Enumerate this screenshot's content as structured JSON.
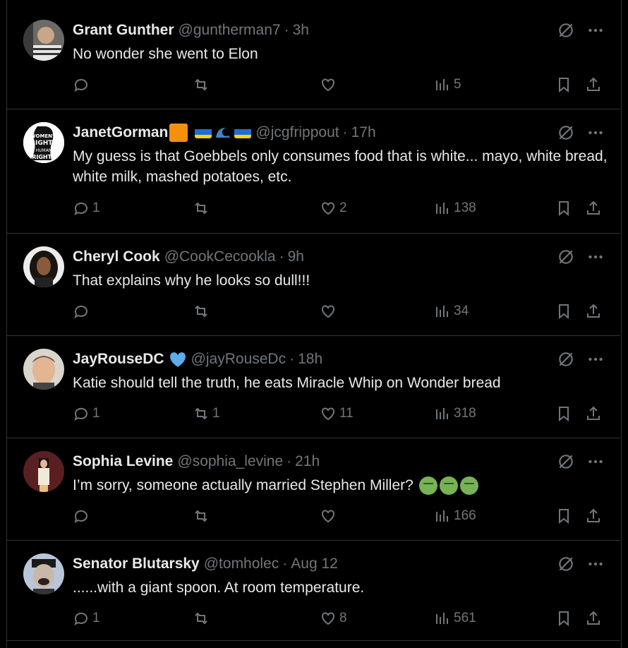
{
  "tweets": [
    {
      "name": "Grant Gunther",
      "handle": "@guntherman7",
      "time": "3h",
      "text": "No wonder she went to Elon",
      "replies": "",
      "retweets": "",
      "likes": "",
      "views": "5"
    },
    {
      "name": "JanetGorman",
      "handle": "@jcgfrippout",
      "time": "17h",
      "text": "My guess is that Goebbels only consumes food that is white... mayo, white bread, white milk, mashed potatoes, etc.",
      "replies": "1",
      "retweets": "",
      "likes": "2",
      "views": "138",
      "avatar_text": "WOMEN'S RIGHTS ARE HUMAN RIGHTS"
    },
    {
      "name": "Cheryl Cook",
      "handle": "@CookCecookla",
      "time": "9h",
      "text": "That explains why he looks so dull!!!",
      "replies": "",
      "retweets": "",
      "likes": "",
      "views": "34"
    },
    {
      "name": "JayRouseDC",
      "handle": "@jayRouseDc",
      "time": "18h",
      "text": "Katie should tell the truth, he eats Miracle Whip on Wonder bread",
      "replies": "1",
      "retweets": "1",
      "likes": "11",
      "views": "318"
    },
    {
      "name": "Sophia Levine",
      "handle": "@sophia_levine",
      "time": "21h",
      "text": "I’m sorry, someone actually married Stephen Miller?",
      "replies": "",
      "retweets": "",
      "likes": "",
      "views": "166"
    },
    {
      "name": "Senator Blutarsky",
      "handle": "@tomholec",
      "time": "Aug 12",
      "text": "......with a giant spoon. At room temperature.",
      "replies": "1",
      "retweets": "",
      "likes": "8",
      "views": "561"
    }
  ],
  "colors": {
    "background": "#000000",
    "text": "#e7e9ea",
    "muted": "#71767b",
    "verified": "#1d9bf0"
  }
}
